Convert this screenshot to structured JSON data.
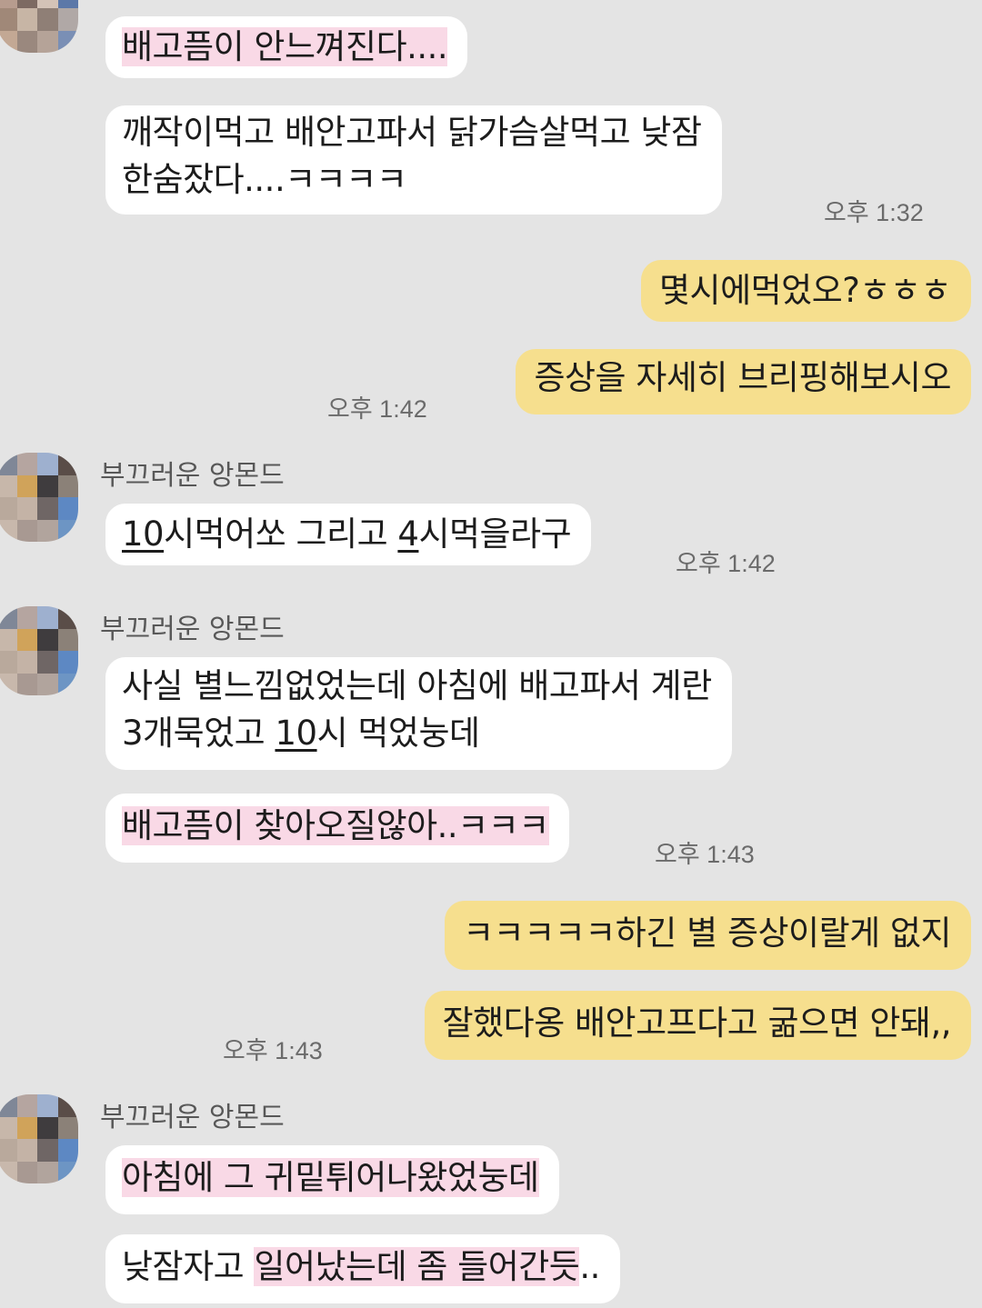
{
  "sender_name": "부끄러운 앙몬드",
  "messages": {
    "m1": "배고픔이 안느껴진다....",
    "m2_line1": "깨작이먹고 배안고파서 닭가슴살먹고 낮잠",
    "m2_line2": "한숨잤다....ㅋㅋㅋㅋ",
    "m3": "몇시에먹었오?ㅎㅎㅎ",
    "m4": "증상을 자세히 브리핑해보시오",
    "m5": {
      "a": "10",
      "b": "시먹어쏘 그리고 ",
      "c": "4",
      "d": "시먹을라구"
    },
    "m6": {
      "line1": "사실 별느낌없었는데 아침에 배고파서 계란",
      "a": "3개묵었고 ",
      "b": "10",
      "c": "시 먹었눙데"
    },
    "m7": "배고픔이 찾아오질않아..ㅋㅋㅋ",
    "m8": "ㅋㅋㅋㅋㅋ하긴 별 증상이랄게 없지",
    "m9": "잘했다옹 배안고프다고 굶으면 안돼,,",
    "m10": "아침에 그 귀밑튀어나왔었눙데",
    "m11": {
      "a": "낮잠자고 ",
      "b": "일어났는데 좀 들어간듯",
      "c": ".."
    }
  },
  "times": {
    "t1": "오후 1:32",
    "t2": "오후 1:42",
    "t3": "오후 1:42",
    "t4": "오후 1:43",
    "t5": "오후 1:43"
  }
}
